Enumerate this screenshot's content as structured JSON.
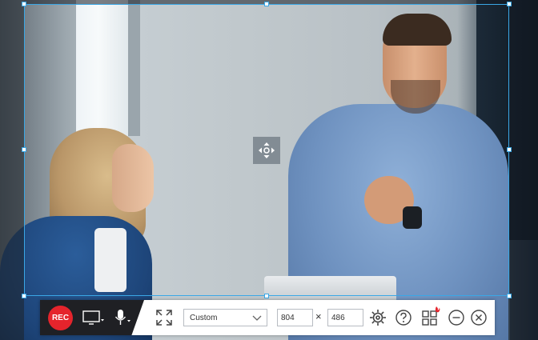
{
  "toolbar": {
    "rec_label": "REC",
    "region_mode": "Custom",
    "width_value": "804",
    "height_value": "486",
    "times_symbol": "×"
  },
  "colors": {
    "selection_border": "#3aa7e6",
    "rec_red": "#e5242c",
    "toolbar_dark": "#1f2024",
    "toolbar_light": "#ffffff"
  },
  "icons": {
    "screen": "monitor-icon",
    "mic": "microphone-icon",
    "fullscreen": "expand-icon",
    "settings": "gear-icon",
    "help": "help-icon",
    "tools": "toolbox-icon",
    "minimize": "minimize-icon",
    "close": "close-icon",
    "move": "move-icon"
  }
}
